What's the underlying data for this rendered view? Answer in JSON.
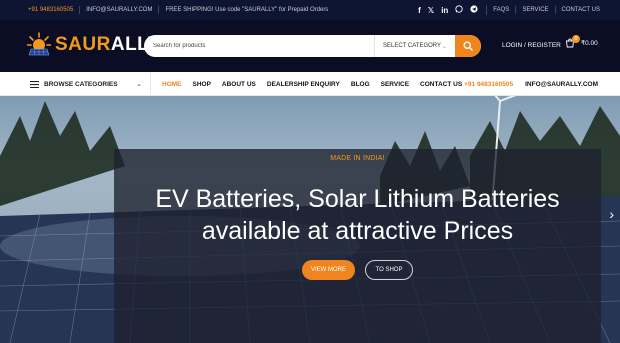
{
  "topbar": {
    "phone": "+91 9483160505",
    "email": "INFO@SAURALLY.COM",
    "promo": "FREE SHIPPING! Use code \"SAURALLY\" for Prepaid Orders",
    "social": [
      "f",
      "𝕏",
      "in",
      "w",
      "t"
    ],
    "links": [
      "FAQS",
      "SERVICE",
      "CONTACT US"
    ]
  },
  "header": {
    "logo_part1": "SAUR",
    "logo_part2": "ALLY",
    "search_placeholder": "Search for products",
    "category_label": "SELECT CATEGORY",
    "login_label": "LOGIN / REGISTER",
    "cart_count": "0",
    "cart_total": "₹0.00"
  },
  "nav": {
    "browse_label": "BROWSE CATEGORIES",
    "menu": [
      "HOME",
      "SHOP",
      "ABOUT US",
      "DEALERSHIP ENQUIRY",
      "BLOG",
      "SERVICE",
      "CONTACT US"
    ],
    "phone": "+91 9483160505",
    "email": "INFO@SAURALLY.COM"
  },
  "hero": {
    "eyebrow": "MADE IN INDIA!",
    "line1": "EV Batteries, Solar Lithium Batteries",
    "line2": "available at attractive Prices",
    "primary_btn": "VIEW MORE",
    "secondary_btn": "TO SHOP"
  },
  "colors": {
    "accent": "#f0851f",
    "dark_navy": "#0b0d24"
  }
}
